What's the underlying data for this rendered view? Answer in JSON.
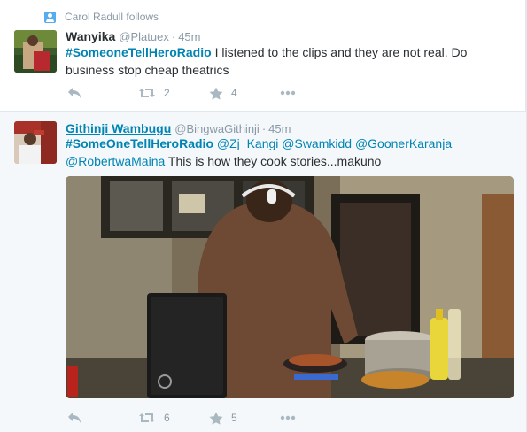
{
  "tweets": [
    {
      "context": "Carol Radull follows",
      "fullname": "Wanyika",
      "username": "@Platuex",
      "separator": "·",
      "time": "45m",
      "hashtag": "#SomeoneTellHeroRadio",
      "text": "I listened to the clips and they are not real. Do business stop cheap theatrics",
      "retweets": "2",
      "favorites": "4"
    },
    {
      "fullname": "Githinji Wambugu",
      "username": "@BingwaGithinji",
      "separator": "·",
      "time": "45m",
      "hashtag": "#SomeOneTellHeroRadio",
      "mentions": [
        "@Zj_Kangi",
        "@Swamkidd",
        "@GoonerKaranja",
        "@RobertwaMaina"
      ],
      "text": "This is how they cook stories...makuno",
      "retweets": "6",
      "favorites": "5"
    }
  ],
  "icons": {
    "reply": "reply-icon",
    "retweet": "retweet-icon",
    "favorite": "star-icon",
    "more": "more-dots-icon",
    "context": "person-follow-icon"
  },
  "colors": {
    "link": "#0084b4",
    "muted": "#8899a6",
    "icon": "#aab8c2",
    "highlight_bg": "#f5f8fa"
  }
}
